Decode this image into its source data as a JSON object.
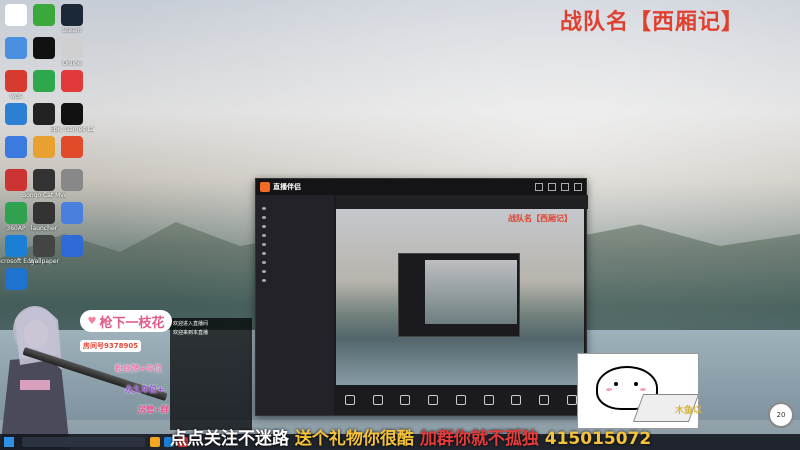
{
  "team_name": "战队名【西厢记】",
  "desktop_icons": [
    {
      "label": "",
      "color": "#ffffff"
    },
    {
      "label": "",
      "color": "#3aa83a"
    },
    {
      "label": "Steam",
      "color": "#1b2838"
    },
    {
      "label": "",
      "color": "#4a8fe0"
    },
    {
      "label": "",
      "color": "#111111"
    },
    {
      "label": "Online",
      "color": "#d0d0d0"
    },
    {
      "label": "wps",
      "color": "#d73b2f"
    },
    {
      "label": "",
      "color": "#2ea84a"
    },
    {
      "label": "",
      "color": "#e23a3a"
    },
    {
      "label": "",
      "color": "#2d7fd3"
    },
    {
      "label": "",
      "color": "#222222"
    },
    {
      "label": "Epic Games Launcher",
      "color": "#111111"
    },
    {
      "label": "",
      "color": "#3b7be0"
    },
    {
      "label": "",
      "color": "#e8a030"
    },
    {
      "label": "",
      "color": "#e24a2a"
    },
    {
      "label": "",
      "color": "#c33"
    },
    {
      "label": "Bongo Cat Mver",
      "color": "#333"
    },
    {
      "label": "",
      "color": "#888"
    },
    {
      "label": "360AP",
      "color": "#2fa14f"
    },
    {
      "label": "launcher",
      "color": "#333"
    },
    {
      "label": "",
      "color": "#4a7fe0"
    },
    {
      "label": "Microsoft Edge",
      "color": "#1c7fd6"
    },
    {
      "label": "Wallpaper",
      "color": "#444"
    },
    {
      "label": "",
      "color": "#2f6bd6"
    },
    {
      "label": "",
      "color": "#1e73d0"
    }
  ],
  "app": {
    "title": "直播伴侣",
    "version": "",
    "titlebar_text": "",
    "sidebar_tabs": [
      "",
      "",
      ""
    ],
    "scenes": [
      "",
      "",
      "",
      "",
      "",
      "",
      "",
      "",
      ""
    ],
    "topstrip_pills": [
      "",
      "",
      ""
    ],
    "preview_team": "战队名【西厢记】",
    "bottom_buttons": [
      "",
      "",
      "",
      "",
      "",
      "",
      "",
      "",
      ""
    ]
  },
  "overlay": {
    "streamer_name": "枪下一枝花",
    "room_no": "房间号9378905",
    "perks": [
      "粉丝牌+车位",
      "永久车位+",
      "房管+群"
    ],
    "chat_lines": [
      "",
      "欢迎进入直播间",
      "欢迎来到本直播",
      "",
      "",
      "",
      "",
      "",
      "",
      ""
    ]
  },
  "ticker": {
    "part1": "点点关注不迷路",
    "part2": "送个礼物你很酷",
    "part3": "加群你就不孤独",
    "part4": "415015072"
  },
  "cat_logo": "木鱼以",
  "counter_value": "20",
  "taskbar": {
    "search_placeholder": "",
    "clock": ""
  }
}
